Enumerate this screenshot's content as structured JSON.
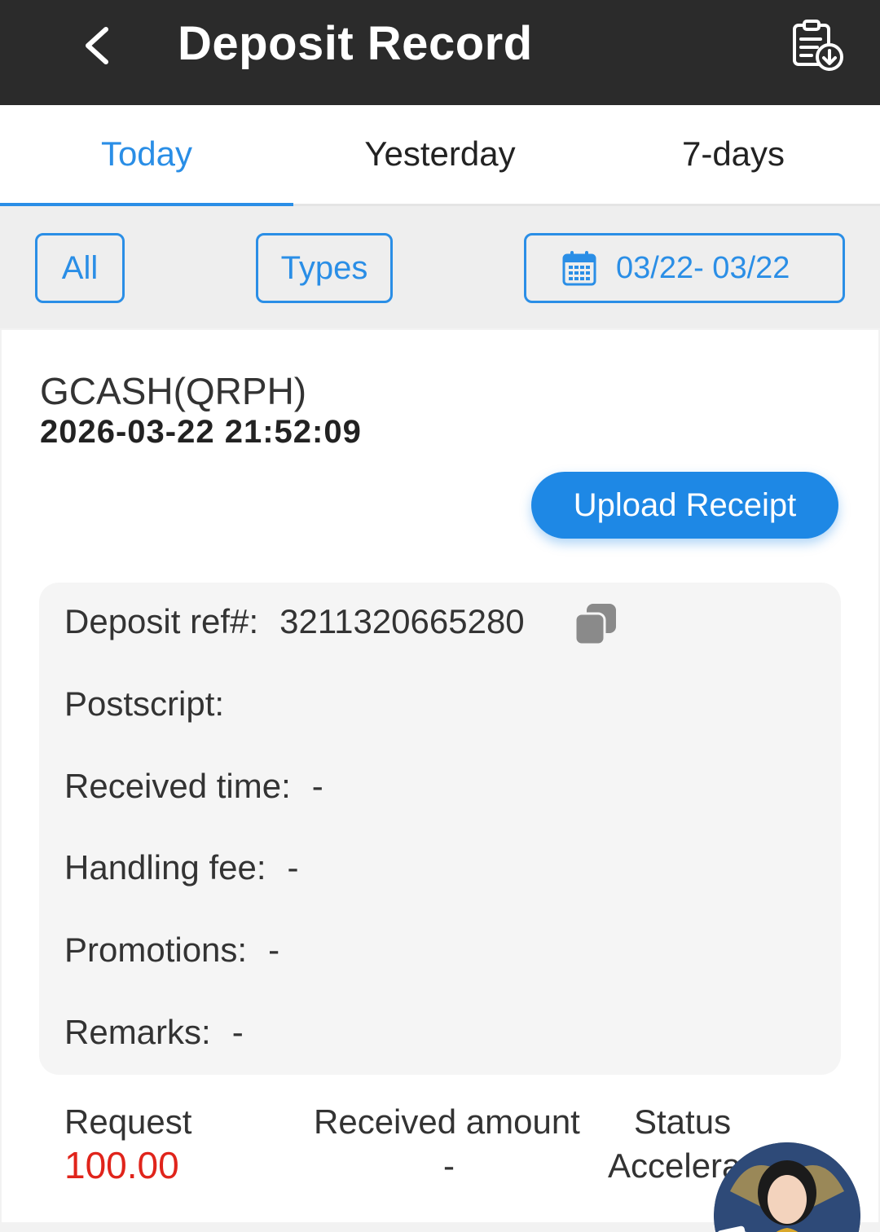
{
  "header": {
    "title": "Deposit Record",
    "back_icon": "chevron-left-icon",
    "download_icon": "clipboard-download-icon"
  },
  "tabs": [
    {
      "label": "Today",
      "active": true
    },
    {
      "label": "Yesterday",
      "active": false
    },
    {
      "label": "7-days",
      "active": false
    }
  ],
  "filters": {
    "all_label": "All",
    "types_label": "Types",
    "date_range": "03/22- 03/22",
    "calendar_icon": "calendar-icon"
  },
  "record": {
    "method": "GCASH(QRPH)",
    "datetime": "2026-03-22 21:52:09",
    "upload_label": "Upload Receipt",
    "details": {
      "deposit_ref_label": "Deposit ref#:",
      "deposit_ref_value": "3211320665280",
      "postscript_label": "Postscript:",
      "received_time_label": "Received time:",
      "received_time_value": "-",
      "handling_fee_label": "Handling fee:",
      "handling_fee_value": "-",
      "promotions_label": "Promotions:",
      "promotions_value": "-",
      "remarks_label": "Remarks:",
      "remarks_value": "-"
    },
    "summary": {
      "request_label": "Request",
      "request_value": "100.00",
      "received_amount_label": "Received amount",
      "received_amount_value": "-",
      "status_label": "Status",
      "status_value": "Accelera"
    }
  },
  "colors": {
    "accent": "#2a8ee6",
    "header_bg": "#2b2b2b",
    "request_red": "#e0241b",
    "button_blue": "#1e88e5"
  }
}
